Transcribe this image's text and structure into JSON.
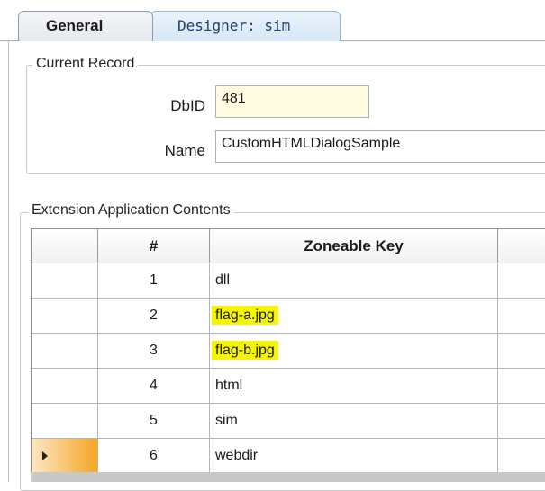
{
  "tabs": [
    {
      "label": "General",
      "active": true
    },
    {
      "label": "Designer: sim",
      "active": false
    }
  ],
  "current_record": {
    "legend": "Current Record",
    "dbid_label": "DbID",
    "dbid_value": "481",
    "name_label": "Name",
    "name_value": "CustomHTMLDialogSample"
  },
  "extension": {
    "legend": "Extension Application Contents",
    "columns": [
      "",
      "#",
      "Zoneable Key",
      ""
    ],
    "rows": [
      {
        "num": "1",
        "key": "dll",
        "highlighted": false,
        "current": false
      },
      {
        "num": "2",
        "key": "flag-a.jpg",
        "highlighted": true,
        "current": false
      },
      {
        "num": "3",
        "key": "flag-b.jpg",
        "highlighted": true,
        "current": false
      },
      {
        "num": "4",
        "key": "html",
        "highlighted": false,
        "current": false
      },
      {
        "num": "5",
        "key": "sim",
        "highlighted": false,
        "current": false
      },
      {
        "num": "6",
        "key": "webdir",
        "highlighted": false,
        "current": true
      }
    ]
  },
  "colors": {
    "highlight": "#f5f500",
    "dbid_field_bg": "#fffbe0",
    "current_row_marker": "#f5a623"
  },
  "icons": {
    "current_row": "row-pointer-icon"
  }
}
